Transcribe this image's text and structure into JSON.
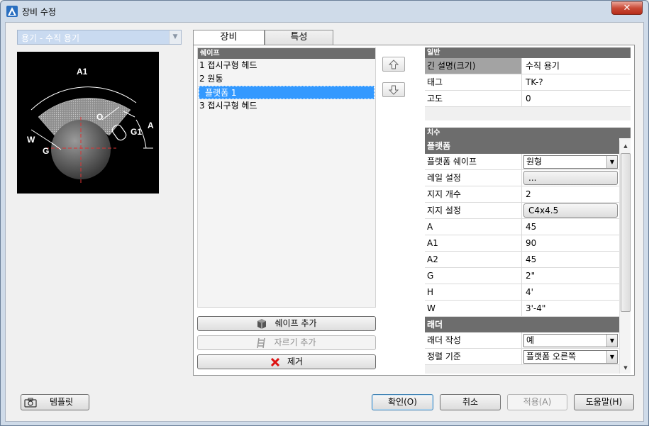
{
  "window": {
    "title": "장비 수정",
    "close_label": "✕"
  },
  "equipment_combo": {
    "value": "용기 - 수직 용기"
  },
  "preview": {
    "labels": [
      "A1",
      "O",
      "G1",
      "A",
      "W",
      "G"
    ]
  },
  "tabs": [
    {
      "label": "장비"
    },
    {
      "label": "특성"
    }
  ],
  "shapes": {
    "header": "쉐이프",
    "items": [
      {
        "label": "1 접시구형 헤드"
      },
      {
        "label": "2 원통"
      },
      {
        "label": "플랫폼 1"
      },
      {
        "label": "3 접시구형 헤드"
      }
    ],
    "selected_index": 2
  },
  "buttons": {
    "add_shape": "쉐이프 추가",
    "add_cut": "자르기 추가",
    "remove": "제거"
  },
  "general": {
    "header": "일반",
    "rows": [
      {
        "key": "긴 설명(크기)",
        "value": "수직 용기"
      },
      {
        "key": "태그",
        "value": "TK-?"
      },
      {
        "key": "고도",
        "value": "0"
      }
    ]
  },
  "dimensions": {
    "header": "치수",
    "platform_category": "플랫폼",
    "platform_shape": {
      "key": "플랫폼 쉐이프",
      "value": "원형"
    },
    "rail_setting": {
      "key": "레일 설정",
      "value": "..."
    },
    "support_count": {
      "key": "지지 개수",
      "value": "2"
    },
    "support_setting": {
      "key": "지지 설정",
      "value": "C4x4.5"
    },
    "rows": [
      {
        "key": "A",
        "value": "45"
      },
      {
        "key": "A1",
        "value": "90"
      },
      {
        "key": "A2",
        "value": "45"
      },
      {
        "key": "G",
        "value": "2\""
      },
      {
        "key": "H",
        "value": "4'"
      },
      {
        "key": "W",
        "value": "3'-4\""
      }
    ],
    "ladder_category": "래더",
    "create_ladder": {
      "key": "래더 작성",
      "value": "예"
    },
    "align_basis": {
      "key": "정렬 기준",
      "value": "플랫폼 오른쪽"
    }
  },
  "footer": {
    "template": "템플릿",
    "ok": "확인(O)",
    "cancel": "취소",
    "apply": "적용(A)",
    "help": "도움말(H)"
  },
  "colors": {
    "selection": "#3399ff",
    "header_bg": "#6d6d6d",
    "close_red": "#c94a36"
  }
}
